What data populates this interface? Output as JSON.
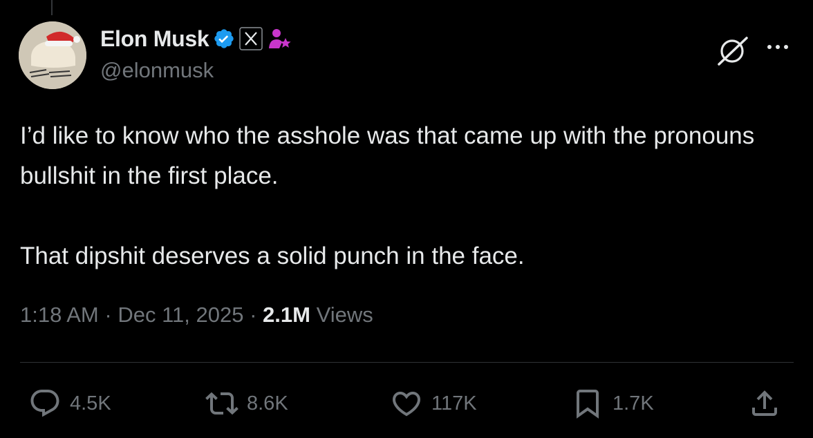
{
  "author": {
    "display_name": "Elon Musk",
    "handle": "@elonmusk",
    "verified_badge_icon": "verified-checkmark-icon",
    "affiliate_badge_icon": "x-logo-icon",
    "role_badge_icon": "user-star-icon"
  },
  "header_actions": {
    "grok_icon": "grok-icon",
    "more_icon": "more-dots-icon"
  },
  "tweet": {
    "paragraphs": [
      "I’d like to know who the asshole was that came up with the pronouns bullshit in the first place.",
      "That dipshit deserves a solid punch in the face."
    ],
    "time": "1:18 AM",
    "date": "Dec 11, 2025",
    "separator": "·",
    "views_count": "2.1M",
    "views_label": "Views"
  },
  "actions": {
    "replies": "4.5K",
    "reposts": "8.6K",
    "likes": "117K",
    "bookmarks": "1.7K"
  },
  "colors": {
    "background": "#000000",
    "text_primary": "#e7e9ea",
    "text_secondary": "#71767b",
    "verified_blue": "#1d9bf0",
    "role_purple": "#c936cc",
    "divider": "#2f3336"
  }
}
